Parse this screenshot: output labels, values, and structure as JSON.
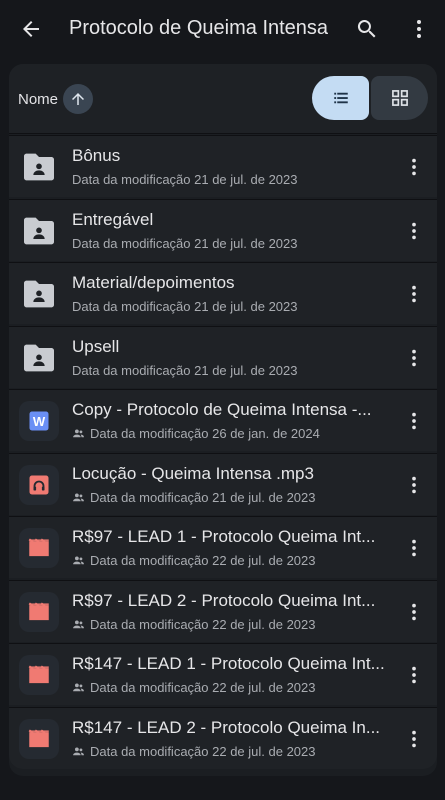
{
  "header": {
    "title": "Protocolo de Queima Intensa",
    "icons": [
      "arrow-back-icon",
      "search-icon",
      "more-vert-icon"
    ]
  },
  "sort": {
    "label": "Nome",
    "direction_icon": "arrow-up-icon",
    "view_options": [
      "list-view-icon",
      "grid-view-icon"
    ],
    "selected_view": "list"
  },
  "colors": {
    "folder": "#c9ccd1",
    "doc_blue": "#6a8ff5",
    "audio_red": "#f07a72",
    "video_red": "#f07a72"
  },
  "files": [
    {
      "name": "Bônus",
      "meta": "Data da modificação 21 de jul. de 2023",
      "type": "folder",
      "shared": false
    },
    {
      "name": "Entregável",
      "meta": "Data da modificação 21 de jul. de 2023",
      "type": "folder",
      "shared": false
    },
    {
      "name": "Material/depoimentos",
      "meta": "Data da modificação 21 de jul. de 2023",
      "type": "folder",
      "shared": false
    },
    {
      "name": "Upsell",
      "meta": "Data da modificação 21 de jul. de 2023",
      "type": "folder",
      "shared": false
    },
    {
      "name": "Copy - Protocolo de Queima Intensa -...",
      "meta": "Data da modificação 26 de jan. de 2024",
      "type": "doc",
      "shared": true
    },
    {
      "name": "Locução - Queima Intensa .mp3",
      "meta": "Data da modificação 21 de jul. de 2023",
      "type": "audio",
      "shared": true
    },
    {
      "name": "R$97 - LEAD 1 - Protocolo Queima Int...",
      "meta": "Data da modificação 22 de jul. de 2023",
      "type": "video",
      "shared": true
    },
    {
      "name": "R$97 - LEAD 2 - Protocolo Queima Int...",
      "meta": "Data da modificação 22 de jul. de 2023",
      "type": "video",
      "shared": true
    },
    {
      "name": "R$147 - LEAD 1 - Protocolo Queima Int...",
      "meta": "Data da modificação 22 de jul. de 2023",
      "type": "video",
      "shared": true
    },
    {
      "name": "R$147 - LEAD 2 - Protocolo Queima In...",
      "meta": "Data da modificação 22 de jul. de 2023",
      "type": "video",
      "shared": true
    }
  ]
}
